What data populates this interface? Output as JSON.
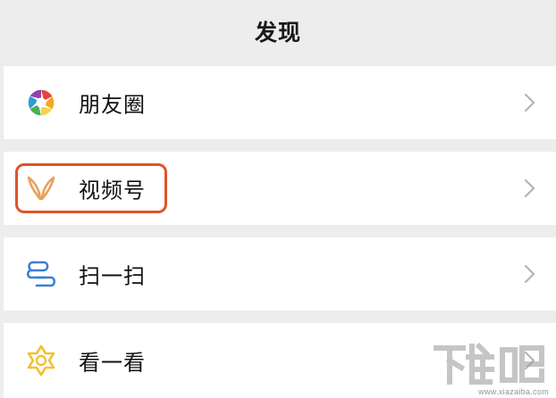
{
  "header": {
    "title": "发现"
  },
  "menu": {
    "items": [
      {
        "label": "朋友圈",
        "icon": "moments-aperture-icon"
      },
      {
        "label": "视频号",
        "icon": "channels-butterfly-icon"
      },
      {
        "label": "扫一扫",
        "icon": "scan-icon"
      },
      {
        "label": "看一看",
        "icon": "look-star-icon"
      }
    ],
    "chevron_icon": "chevron-right-icon"
  },
  "annotation": {
    "highlight_color": "#e1532a"
  },
  "watermark": {
    "logo": "下载吧",
    "text": "www.xiazaiba.com"
  },
  "colors": {
    "background": "#ededed",
    "row_background": "#ffffff",
    "channels_icon": "#e8a15a",
    "scan_icon": "#3a7fd5",
    "look_icon": "#f1c232"
  }
}
